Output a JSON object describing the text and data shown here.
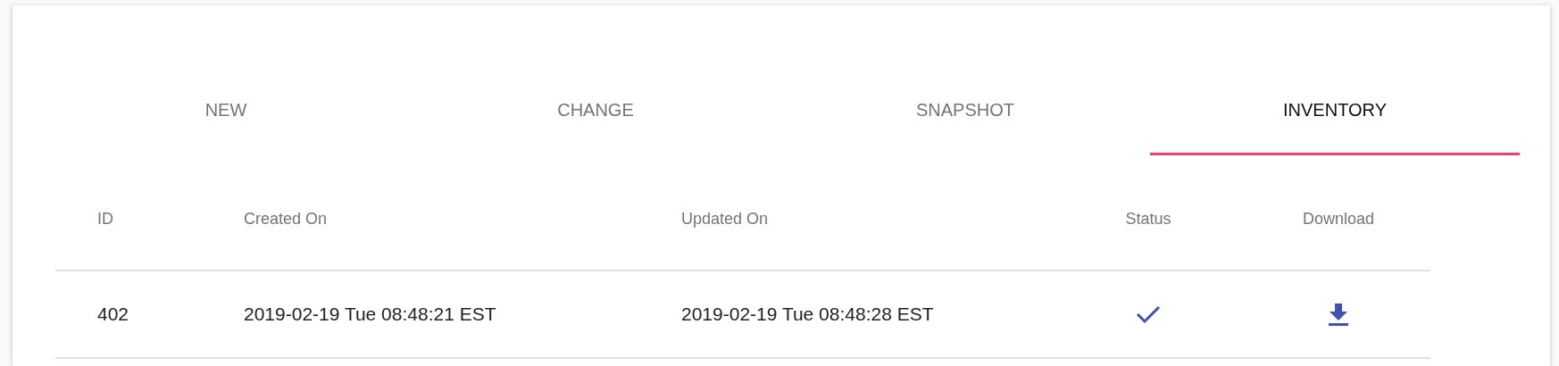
{
  "tabs": [
    {
      "label": "NEW",
      "selected": false
    },
    {
      "label": "CHANGE",
      "selected": false
    },
    {
      "label": "SNAPSHOT",
      "selected": false
    },
    {
      "label": "INVENTORY",
      "selected": true
    }
  ],
  "table": {
    "columns": [
      "ID",
      "Created On",
      "Updated On",
      "Status",
      "Download"
    ],
    "rows": [
      {
        "id": "402",
        "created_on": "2019-02-19 Tue 08:48:21 EST",
        "updated_on": "2019-02-19 Tue 08:48:28 EST",
        "done": true
      }
    ]
  }
}
